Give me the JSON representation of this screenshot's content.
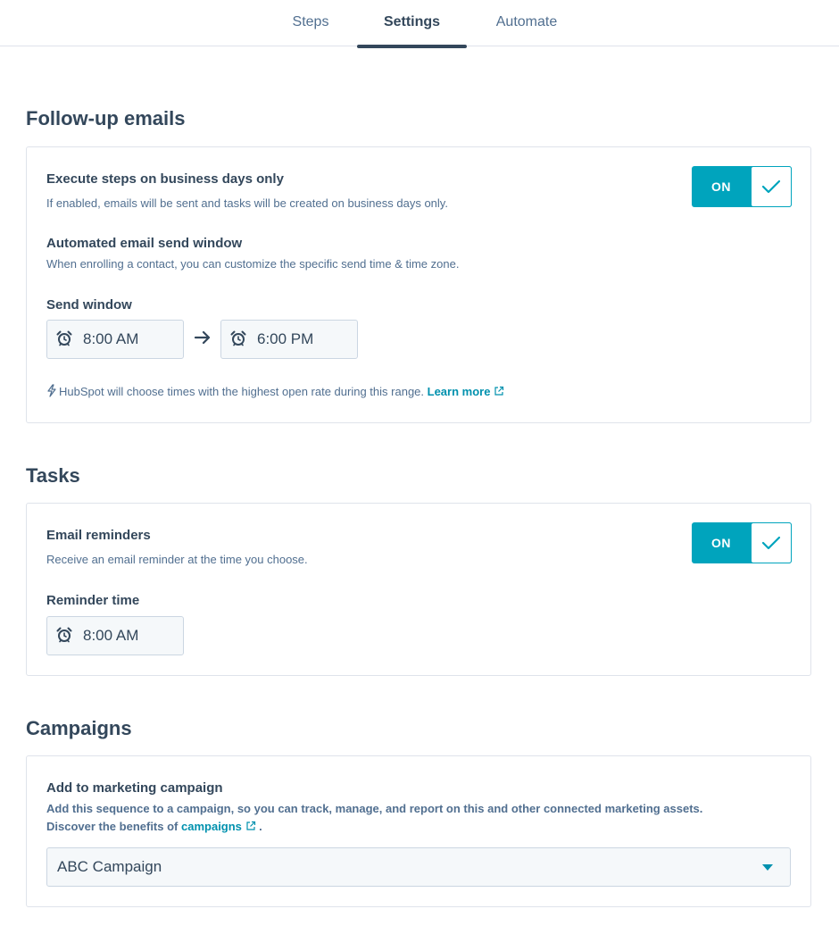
{
  "tabs": [
    {
      "label": "Steps"
    },
    {
      "label": "Settings"
    },
    {
      "label": "Automate"
    }
  ],
  "follow_up": {
    "heading": "Follow-up emails",
    "business_days_label": "Execute steps on business days only",
    "business_days_help": "If enabled, emails will be sent and tasks will be created on business days only.",
    "business_days_toggle": "ON",
    "send_window_heading": "Automated email send window",
    "send_window_help": "When enrolling a contact, you can customize the specific send time & time zone.",
    "send_window_label": "Send window",
    "start_time": "8:00 AM",
    "end_time": "6:00 PM",
    "hint_text": "HubSpot will choose times with the highest open rate during this range.",
    "learn_more": "Learn more"
  },
  "tasks": {
    "heading": "Tasks",
    "reminders_label": "Email reminders",
    "reminders_help": "Receive an email reminder at the time you choose.",
    "reminders_toggle": "ON",
    "reminder_time_label": "Reminder time",
    "reminder_time": "8:00 AM"
  },
  "campaigns": {
    "heading": "Campaigns",
    "add_label": "Add to marketing campaign",
    "description": "Add this sequence to a campaign, so you can track, manage, and report on this and other connected marketing assets.",
    "discover_prefix": "Discover the benefits of",
    "discover_link": "campaigns",
    "discover_suffix": ".",
    "selected_campaign": "ABC Campaign"
  },
  "colors": {
    "accent": "#00a4bd",
    "link": "#0091ae",
    "text": "#33475b",
    "muted": "#516f90"
  }
}
